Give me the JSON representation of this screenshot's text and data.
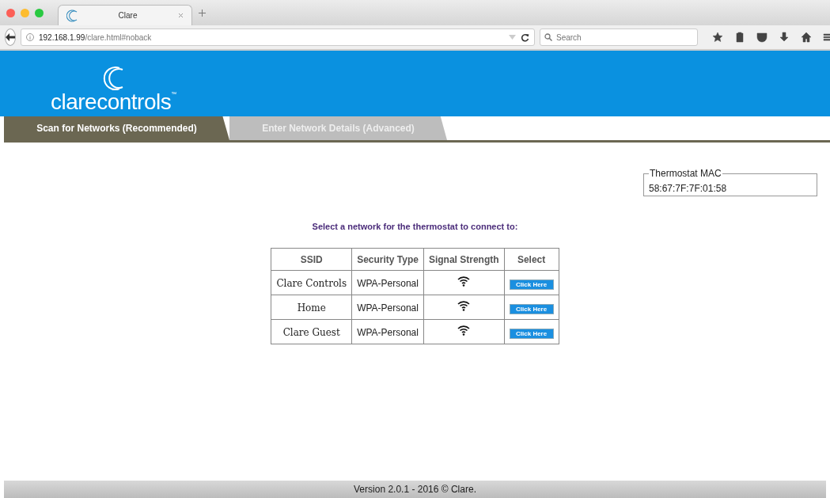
{
  "browser": {
    "tab_title": "Clare",
    "address": "**192.168.1.99**/clare.html#noback",
    "search": {
      "placeholder": "Search"
    }
  },
  "header": {
    "logo_text": "clarecontrols",
    "logo_mark": "™"
  },
  "tabs": [
    {
      "label": "Scan for Networks (Recommended)",
      "selected": true
    },
    {
      "label": "Enter Network Details (Advanced)",
      "selected": false
    }
  ],
  "mac": {
    "legend": "Thermostat MAC",
    "value": "58:67:7F:7F:01:58"
  },
  "prompt": "Select a network for the thermostat to connect to:",
  "table": {
    "columns": [
      "SSID",
      "Security Type",
      "Signal Strength",
      "Select"
    ],
    "rows": [
      {
        "ssid": "Clare Controls",
        "security": "WPA-Personal",
        "button": "Click Here"
      },
      {
        "ssid": "Home",
        "security": "WPA-Personal",
        "button": "Click Here"
      },
      {
        "ssid": "Clare Guest",
        "security": "WPA-Personal",
        "button": "Click Here"
      }
    ]
  },
  "footer": "Version 2.0.1 - 2016 © Clare."
}
